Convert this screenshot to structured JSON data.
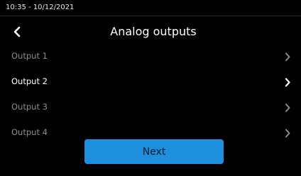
{
  "status_bar": {
    "datetime": "10:35 - 10/12/2021"
  },
  "header": {
    "back_icon": "chevron-left-icon",
    "title": "Analog outputs"
  },
  "outputs": [
    {
      "label": "Output 1",
      "state": "inactive",
      "icon": "chevron-right-icon"
    },
    {
      "label": "Output 2",
      "state": "active",
      "icon": "chevron-right-icon"
    },
    {
      "label": "Output 3",
      "state": "inactive",
      "icon": "chevron-right-icon"
    },
    {
      "label": "Output 4",
      "state": "inactive",
      "icon": "chevron-right-icon"
    }
  ],
  "footer": {
    "next_label": "Next"
  },
  "colors": {
    "background": "#000000",
    "accent": "#1e8fdc",
    "text_active": "#ffffff",
    "text_inactive": "#8c8c8c"
  }
}
